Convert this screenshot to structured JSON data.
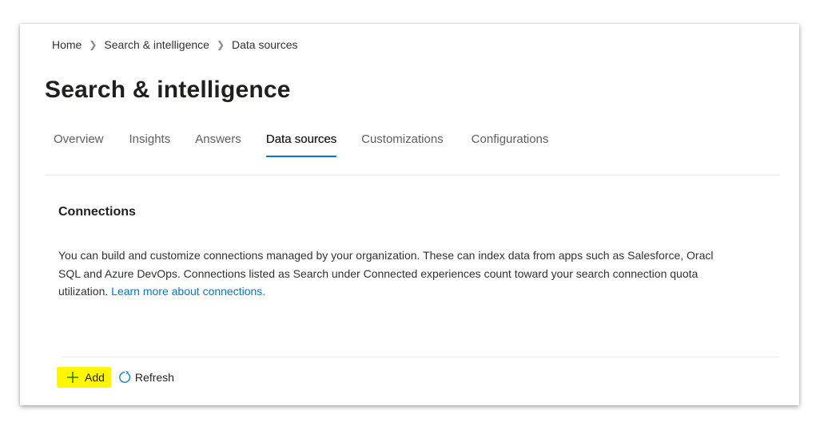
{
  "breadcrumb": {
    "items": [
      "Home",
      "Search & intelligence",
      "Data sources"
    ],
    "separator": ">"
  },
  "page": {
    "title": "Search & intelligence"
  },
  "tabs": [
    {
      "label": "Overview",
      "active": false
    },
    {
      "label": "Insights",
      "active": false
    },
    {
      "label": "Answers",
      "active": false
    },
    {
      "label": "Data sources",
      "active": true
    },
    {
      "label": "Customizations",
      "active": false
    },
    {
      "label": "Configurations",
      "active": false
    }
  ],
  "connections": {
    "title": "Connections",
    "description_line1": "You can build and customize connections managed by your organization. These can index data from apps such as Salesforce, Oracl",
    "description_line2": "SQL and Azure DevOps. Connections listed as Search under Connected experiences count toward your search connection quota",
    "description_line3": "utilization.",
    "learn_more_link": "Learn more about connections."
  },
  "toolbar": {
    "add_label": "Add",
    "add_icon": "plus-icon",
    "refresh_label": "Refresh",
    "refresh_icon": "refresh-icon"
  },
  "colors": {
    "accent": "#0078d4",
    "highlight": "#fff700",
    "text": "#323130"
  }
}
